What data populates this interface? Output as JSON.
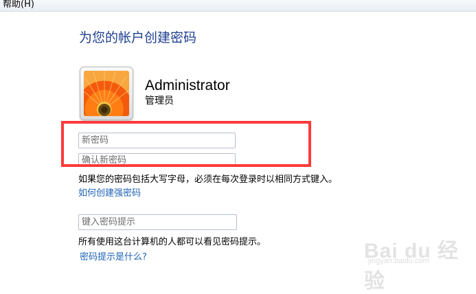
{
  "menu": {
    "help": "帮助(H)"
  },
  "page": {
    "title": "为您的帐户创建密码"
  },
  "user": {
    "name": "Administrator",
    "role": "管理员"
  },
  "fields": {
    "new_password_placeholder": "新密码",
    "confirm_password_placeholder": "确认新密码",
    "hint_placeholder": "键入密码提示"
  },
  "text": {
    "case_note": "如果您的密码包括大写字母，必须在每次登录时以相同方式键入。",
    "strong_password_link": "如何创建强密码",
    "hint_note": "所有使用这台计算机的人都可以看见密码提示。",
    "hint_link": "密码提示是什么?"
  },
  "watermark": {
    "main": "Bai du 经验",
    "sub": "jingyan.baidu.com"
  },
  "colors": {
    "title_blue": "#1e3f8f",
    "link_blue": "#1c63b7",
    "highlight_red": "#ff3a3a"
  }
}
